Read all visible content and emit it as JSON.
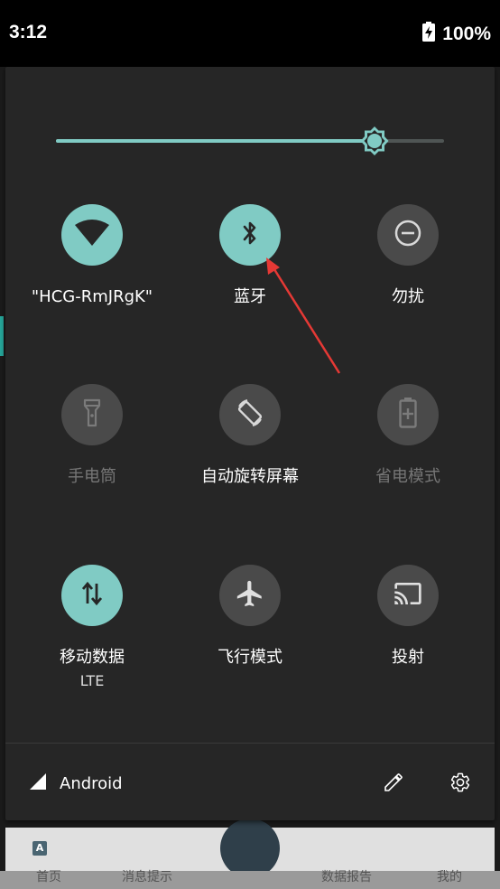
{
  "status_bar": {
    "time": "3:12",
    "battery_percent": "100%",
    "battery_icon": "battery-charging-icon"
  },
  "brightness": {
    "level": 0.82,
    "icon": "brightness-icon"
  },
  "tiles": [
    {
      "label": "\"HCG-RmJRgK\"",
      "icon": "wifi-icon",
      "state": "on"
    },
    {
      "label": "蓝牙",
      "icon": "bluetooth-icon",
      "state": "on"
    },
    {
      "label": "勿扰",
      "icon": "do-not-disturb-icon",
      "state": "off"
    },
    {
      "label": "手电筒",
      "icon": "flashlight-icon",
      "state": "unavailable"
    },
    {
      "label": "自动旋转屏幕",
      "icon": "auto-rotate-icon",
      "state": "off"
    },
    {
      "label": "省电模式",
      "icon": "battery-saver-icon",
      "state": "unavailable"
    },
    {
      "label": "移动数据",
      "sublabel": "LTE",
      "icon": "mobile-data-icon",
      "state": "on"
    },
    {
      "label": "飞行模式",
      "icon": "airplane-icon",
      "state": "off"
    },
    {
      "label": "投射",
      "icon": "cast-icon",
      "state": "off"
    }
  ],
  "footer": {
    "network_name": "Android",
    "signal_icon": "signal-icon",
    "edit_icon": "edit-pencil-icon",
    "settings_icon": "settings-gear-icon"
  },
  "background_app": {
    "nav_items": [
      "首页",
      "消息提示",
      "数据报告",
      "我的"
    ]
  },
  "colors": {
    "accent": "#80cbc4",
    "tile_off": "#4a4a4a",
    "panel": "#262626",
    "annotation_arrow": "#e53935"
  }
}
